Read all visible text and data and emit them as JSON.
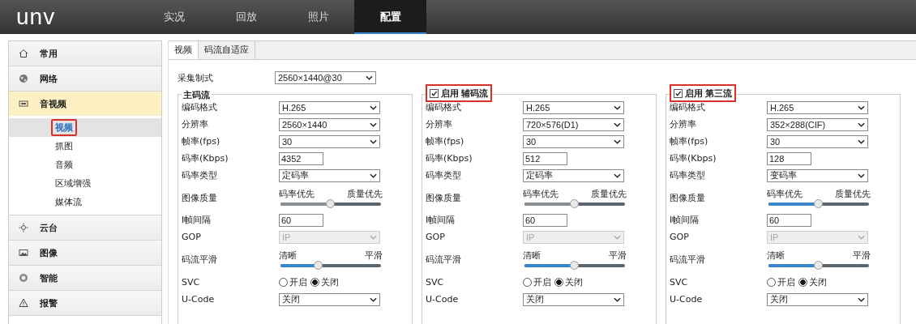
{
  "header": {
    "logo": "unv",
    "nav": [
      {
        "label": "实况",
        "selected": false
      },
      {
        "label": "回放",
        "selected": false
      },
      {
        "label": "照片",
        "selected": false
      },
      {
        "label": "配置",
        "selected": true
      }
    ]
  },
  "sidebar": {
    "items": [
      {
        "label": "常用",
        "kind": "home"
      },
      {
        "label": "网络",
        "kind": "globe"
      },
      {
        "label": "音视频",
        "kind": "av",
        "expanded": true,
        "children": [
          {
            "label": "视频",
            "selected": true,
            "highlighted": true
          },
          {
            "label": "抓图",
            "selected": false,
            "highlighted": false
          },
          {
            "label": "音频",
            "selected": false,
            "highlighted": false
          },
          {
            "label": "区域增强",
            "selected": false,
            "highlighted": false
          },
          {
            "label": "媒体流",
            "selected": false,
            "highlighted": false
          }
        ]
      },
      {
        "label": "云台",
        "kind": "ptz"
      },
      {
        "label": "图像",
        "kind": "image"
      },
      {
        "label": "智能",
        "kind": "smart"
      },
      {
        "label": "报警",
        "kind": "alarm"
      }
    ]
  },
  "tabs": [
    {
      "label": "视频",
      "selected": true
    },
    {
      "label": "码流自适应",
      "selected": false
    }
  ],
  "capture_mode": {
    "label": "采集制式",
    "value": "2560×1440@30"
  },
  "streams": [
    {
      "title": "主码流",
      "highlighted": false,
      "rows": [
        {
          "kind": "select",
          "label": "编码格式",
          "value": "H.265",
          "disabled": false
        },
        {
          "kind": "select",
          "label": "分辨率",
          "value": "2560×1440",
          "disabled": false
        },
        {
          "kind": "select",
          "label": "帧率(fps)",
          "value": "30",
          "disabled": false
        },
        {
          "kind": "input",
          "label": "码率(Kbps)",
          "value": "4352"
        },
        {
          "kind": "select",
          "label": "码率类型",
          "value": "定码率",
          "disabled": false
        },
        {
          "kind": "slider",
          "label": "图像质量",
          "left": "码率优先",
          "right": "质量优先",
          "level": 0.5,
          "disabled": true
        },
        {
          "kind": "input",
          "label": "I帧间隔",
          "value": "60"
        },
        {
          "kind": "select",
          "label": "GOP",
          "value": "IP",
          "disabled": true
        },
        {
          "kind": "slider",
          "label": "码流平滑",
          "left": "清晰",
          "right": "平滑",
          "level": 0.38,
          "disabled": false
        },
        {
          "kind": "radio",
          "label": "SVC",
          "options": [
            {
              "label": "开启",
              "selected": false
            },
            {
              "label": "关闭",
              "selected": true
            }
          ]
        },
        {
          "kind": "select",
          "label": "U-Code",
          "value": "关闭",
          "disabled": false
        }
      ]
    },
    {
      "title": "辅码流",
      "highlighted": true,
      "enable": {
        "label": "启用",
        "checked": true
      },
      "rows": [
        {
          "kind": "select",
          "label": "编码格式",
          "value": "H.265",
          "disabled": false
        },
        {
          "kind": "select",
          "label": "分辨率",
          "value": "720×576(D1)",
          "disabled": false
        },
        {
          "kind": "select",
          "label": "帧率(fps)",
          "value": "30",
          "disabled": false
        },
        {
          "kind": "input",
          "label": "码率(Kbps)",
          "value": "512"
        },
        {
          "kind": "select",
          "label": "码率类型",
          "value": "定码率",
          "disabled": false
        },
        {
          "kind": "slider",
          "label": "图像质量",
          "left": "码率优先",
          "right": "质量优先",
          "level": 0.5,
          "disabled": true
        },
        {
          "kind": "input",
          "label": "I帧间隔",
          "value": "60"
        },
        {
          "kind": "select",
          "label": "GOP",
          "value": "IP",
          "disabled": true
        },
        {
          "kind": "slider",
          "label": "码流平滑",
          "left": "清晰",
          "right": "平滑",
          "level": 0.5,
          "disabled": false
        },
        {
          "kind": "radio",
          "label": "SVC",
          "options": [
            {
              "label": "开启",
              "selected": false
            },
            {
              "label": "关闭",
              "selected": true
            }
          ]
        },
        {
          "kind": "select",
          "label": "U-Code",
          "value": "关闭",
          "disabled": false
        }
      ]
    },
    {
      "title": "第三流",
      "highlighted": true,
      "enable": {
        "label": "启用",
        "checked": true
      },
      "rows": [
        {
          "kind": "select",
          "label": "编码格式",
          "value": "H.265",
          "disabled": false
        },
        {
          "kind": "select",
          "label": "分辨率",
          "value": "352×288(CIF)",
          "disabled": false
        },
        {
          "kind": "select",
          "label": "帧率(fps)",
          "value": "30",
          "disabled": false
        },
        {
          "kind": "input",
          "label": "码率(Kbps)",
          "value": "128"
        },
        {
          "kind": "select",
          "label": "码率类型",
          "value": "变码率",
          "disabled": false
        },
        {
          "kind": "slider",
          "label": "图像质量",
          "left": "码率优先",
          "right": "质量优先",
          "level": 0.5,
          "disabled": false
        },
        {
          "kind": "input",
          "label": "I帧间隔",
          "value": "60"
        },
        {
          "kind": "select",
          "label": "GOP",
          "value": "IP",
          "disabled": true
        },
        {
          "kind": "slider",
          "label": "码流平滑",
          "left": "清晰",
          "right": "平滑",
          "level": 0.5,
          "disabled": false
        },
        {
          "kind": "radio",
          "label": "SVC",
          "options": [
            {
              "label": "开启",
              "selected": false
            },
            {
              "label": "关闭",
              "selected": true
            }
          ]
        },
        {
          "kind": "select",
          "label": "U-Code",
          "value": "关闭",
          "disabled": false
        }
      ]
    }
  ]
}
